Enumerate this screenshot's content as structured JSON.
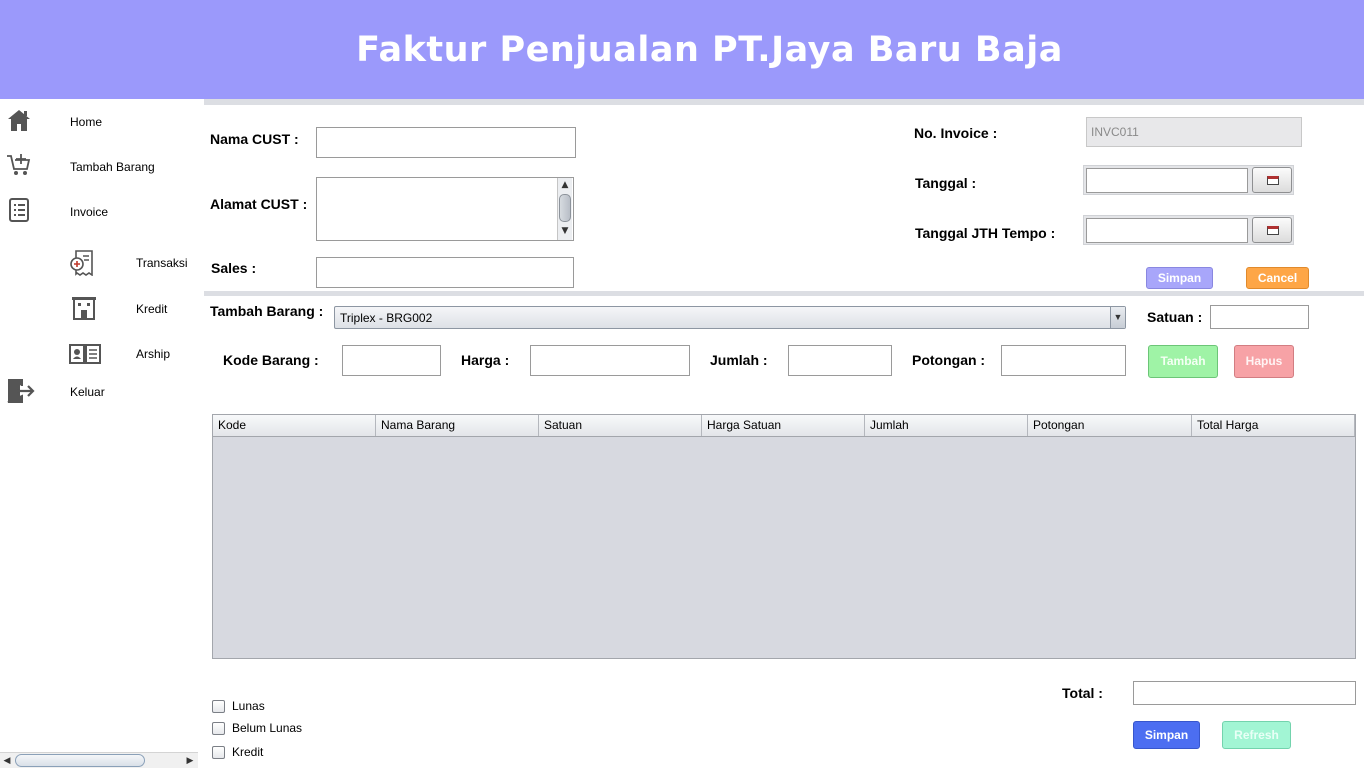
{
  "header": {
    "title": "Faktur Penjualan PT.Jaya Baru Baja"
  },
  "colors": {
    "header_bg": "#9b99fb",
    "simpan_top": "#a8a6fa",
    "cancel": "#fea646",
    "tambah": "#9ff3a6",
    "hapus": "#f7a2a6",
    "simpan_bottom": "#4c6ef1",
    "refresh": "#a2f5d4"
  },
  "sidebar": {
    "items": [
      {
        "label": "Home",
        "icon": "home-icon"
      },
      {
        "label": "Tambah Barang",
        "icon": "cart-plus-icon"
      },
      {
        "label": "Invoice",
        "icon": "invoice-list-icon"
      },
      {
        "label": "Transaksi",
        "icon": "receipt-icon"
      },
      {
        "label": "Kredit",
        "icon": "building-icon"
      },
      {
        "label": "Arship",
        "icon": "open-book-icon"
      },
      {
        "label": "Keluar",
        "icon": "logout-icon"
      }
    ]
  },
  "form": {
    "nama_cust_label": "Nama CUST :",
    "nama_cust_value": "",
    "alamat_cust_label": "Alamat CUST :",
    "alamat_cust_value": "",
    "sales_label": "Sales :",
    "sales_value": "",
    "no_invoice_label": "No. Invoice :",
    "no_invoice_value": "INVC011",
    "tanggal_label": "Tanggal :",
    "tanggal_value": "",
    "tanggal_jth_tempo_label": "Tanggal JTH Tempo :",
    "tanggal_jth_tempo_value": "",
    "simpan_label": "Simpan",
    "cancel_label": "Cancel"
  },
  "item_entry": {
    "tambah_barang_label": "Tambah Barang :",
    "tambah_barang_selected": "Triplex - BRG002",
    "satuan_label": "Satuan :",
    "satuan_value": "",
    "kode_barang_label": "Kode Barang :",
    "kode_barang_value": "",
    "harga_label": "Harga :",
    "harga_value": "",
    "jumlah_label": "Jumlah :",
    "jumlah_value": "",
    "potongan_label": "Potongan :",
    "potongan_value": "",
    "tambah_button": "Tambah",
    "hapus_button": "Hapus"
  },
  "table": {
    "columns": [
      "Kode",
      "Nama Barang",
      "Satuan",
      "Harga Satuan",
      "Jumlah",
      "Potongan",
      "Total Harga"
    ],
    "rows": []
  },
  "footer": {
    "total_label": "Total :",
    "total_value": "",
    "status_options": [
      {
        "label": "Lunas",
        "checked": false
      },
      {
        "label": "Belum Lunas",
        "checked": false
      },
      {
        "label": "Kredit",
        "checked": false
      }
    ],
    "simpan_label": "Simpan",
    "refresh_label": "Refresh"
  }
}
